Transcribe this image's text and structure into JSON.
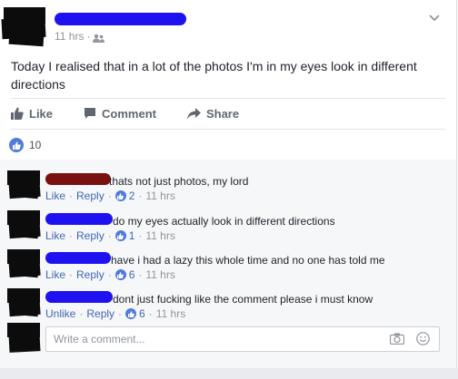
{
  "post": {
    "time_label": "11 hrs",
    "text": "Today I realised that in a lot of the photos I'm in my eyes look in different directions",
    "actions": {
      "like": "Like",
      "comment": "Comment",
      "share": "Share"
    },
    "like_count": "10"
  },
  "comments": [
    {
      "text": "thats not just photos, my lord",
      "like_label": "Like",
      "reply_label": "Reply",
      "likes": "2",
      "time": "11 hrs",
      "name_color": "#7a1010"
    },
    {
      "text": "do my eyes actually look in different directions",
      "like_label": "Like",
      "reply_label": "Reply",
      "likes": "1",
      "time": "11 hrs",
      "name_color": "#1e12f0"
    },
    {
      "text": "have i had a lazy this whole time and no one has told me",
      "like_label": "Like",
      "reply_label": "Reply",
      "likes": "6",
      "time": "11 hrs",
      "name_color": "#1e12f0"
    },
    {
      "text": "dont just fucking like the comment please i must know",
      "like_label": "Unlike",
      "reply_label": "Reply",
      "likes": "6",
      "time": "11 hrs",
      "name_color": "#1e12f0"
    }
  ],
  "composer": {
    "placeholder": "Write a comment..."
  },
  "colors": {
    "link": "#4267b2",
    "like_badge": "#4f7cdc",
    "redaction_blue": "#1e12f0",
    "redaction_red": "#7a1010",
    "redaction_black": "#0c0c0c"
  }
}
